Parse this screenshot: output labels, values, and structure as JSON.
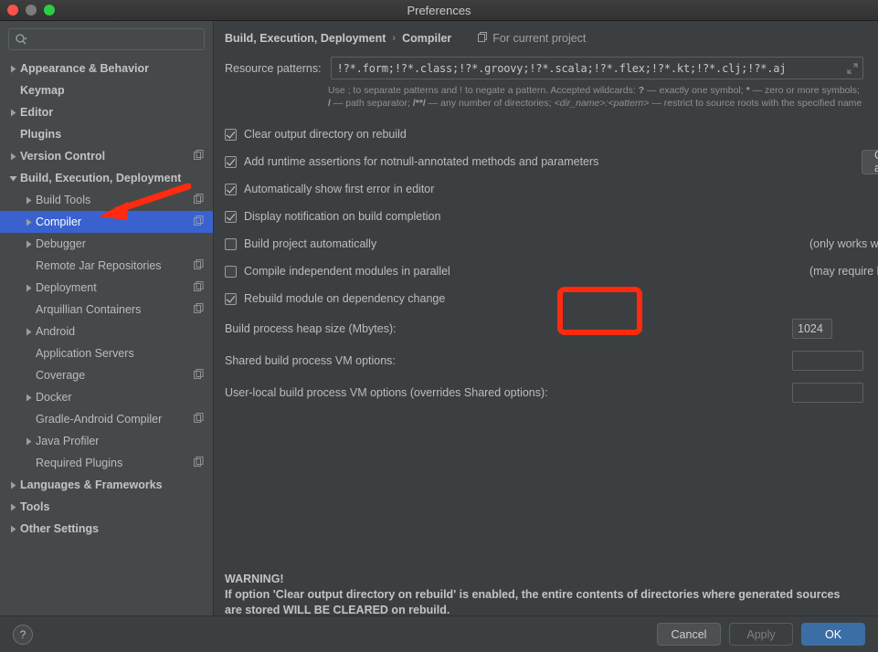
{
  "window": {
    "title": "Preferences",
    "traffic_lights": [
      "close-button",
      "minimize-button",
      "zoom-button"
    ]
  },
  "sidebar": {
    "search": {
      "value": "",
      "placeholder": ""
    },
    "items": [
      {
        "label": "Appearance & Behavior",
        "depth": 0,
        "twisty": "collapsed",
        "bold": true,
        "project_icon": false,
        "selected": false
      },
      {
        "label": "Keymap",
        "depth": 0,
        "twisty": "none",
        "bold": true,
        "project_icon": false,
        "selected": false
      },
      {
        "label": "Editor",
        "depth": 0,
        "twisty": "collapsed",
        "bold": true,
        "project_icon": false,
        "selected": false
      },
      {
        "label": "Plugins",
        "depth": 0,
        "twisty": "none",
        "bold": true,
        "project_icon": false,
        "selected": false
      },
      {
        "label": "Version Control",
        "depth": 0,
        "twisty": "collapsed",
        "bold": true,
        "project_icon": true,
        "selected": false
      },
      {
        "label": "Build, Execution, Deployment",
        "depth": 0,
        "twisty": "expanded",
        "bold": true,
        "project_icon": false,
        "selected": false
      },
      {
        "label": "Build Tools",
        "depth": 1,
        "twisty": "collapsed",
        "bold": false,
        "project_icon": true,
        "selected": false
      },
      {
        "label": "Compiler",
        "depth": 1,
        "twisty": "collapsed",
        "bold": false,
        "project_icon": true,
        "selected": true
      },
      {
        "label": "Debugger",
        "depth": 1,
        "twisty": "collapsed",
        "bold": false,
        "project_icon": false,
        "selected": false
      },
      {
        "label": "Remote Jar Repositories",
        "depth": 1,
        "twisty": "none",
        "bold": false,
        "project_icon": true,
        "selected": false
      },
      {
        "label": "Deployment",
        "depth": 1,
        "twisty": "collapsed",
        "bold": false,
        "project_icon": true,
        "selected": false
      },
      {
        "label": "Arquillian Containers",
        "depth": 1,
        "twisty": "none",
        "bold": false,
        "project_icon": true,
        "selected": false
      },
      {
        "label": "Android",
        "depth": 1,
        "twisty": "collapsed",
        "bold": false,
        "project_icon": false,
        "selected": false
      },
      {
        "label": "Application Servers",
        "depth": 1,
        "twisty": "none",
        "bold": false,
        "project_icon": false,
        "selected": false
      },
      {
        "label": "Coverage",
        "depth": 1,
        "twisty": "none",
        "bold": false,
        "project_icon": true,
        "selected": false
      },
      {
        "label": "Docker",
        "depth": 1,
        "twisty": "collapsed",
        "bold": false,
        "project_icon": false,
        "selected": false
      },
      {
        "label": "Gradle-Android Compiler",
        "depth": 1,
        "twisty": "none",
        "bold": false,
        "project_icon": true,
        "selected": false
      },
      {
        "label": "Java Profiler",
        "depth": 1,
        "twisty": "collapsed",
        "bold": false,
        "project_icon": false,
        "selected": false
      },
      {
        "label": "Required Plugins",
        "depth": 1,
        "twisty": "none",
        "bold": false,
        "project_icon": true,
        "selected": false
      },
      {
        "label": "Languages & Frameworks",
        "depth": 0,
        "twisty": "collapsed",
        "bold": true,
        "project_icon": false,
        "selected": false
      },
      {
        "label": "Tools",
        "depth": 0,
        "twisty": "collapsed",
        "bold": true,
        "project_icon": false,
        "selected": false
      },
      {
        "label": "Other Settings",
        "depth": 0,
        "twisty": "collapsed",
        "bold": true,
        "project_icon": false,
        "selected": false
      }
    ]
  },
  "main": {
    "breadcrumb": {
      "parent": "Build, Execution, Deployment",
      "separator": "›",
      "current": "Compiler",
      "scope_label": "For current project"
    },
    "resource_patterns": {
      "label": "Resource patterns:",
      "value": "!?*.form;!?*.class;!?*.groovy;!?*.scala;!?*.flex;!?*.kt;!?*.clj;!?*.aj",
      "hint_line1_pre": "Use ; to separate patterns and ! to negate a pattern. Accepted wildcards: ",
      "hint_q": "?",
      "hint_q_desc": " — exactly one symbol; ",
      "hint_star": "*",
      "hint_star_desc": " — zero or more symbols; ",
      "hint_slash": "/",
      "hint_slash_desc": " — path separator; ",
      "hint_dblstar": "/**/",
      "hint_dblstar_desc": " — any number of directories; ",
      "hint_dir": "<dir_name>:<pattern>",
      "hint_dir_desc": " — restrict to source roots with the specified name"
    },
    "checkboxes": [
      {
        "label": "Clear output directory on rebuild",
        "checked": true,
        "note": ""
      },
      {
        "label": "Add runtime assertions for notnull-annotated methods and parameters",
        "checked": true,
        "note": ""
      },
      {
        "label": "Automatically show first error in editor",
        "checked": true,
        "note": ""
      },
      {
        "label": "Display notification on build completion",
        "checked": true,
        "note": ""
      },
      {
        "label": "Build project automatically",
        "checked": false,
        "note": "(only works while not running / debugging)"
      },
      {
        "label": "Compile independent modules in parallel",
        "checked": false,
        "note": "(may require larger heap size)"
      },
      {
        "label": "Rebuild module on dependency change",
        "checked": true,
        "note": ""
      }
    ],
    "configure_annotations_button": "Configure annotations...",
    "fields": [
      {
        "label": "Build process heap size (Mbytes):",
        "value": "1024",
        "kind": "small"
      },
      {
        "label": "Shared build process VM options:",
        "value": "",
        "kind": "wide"
      },
      {
        "label": "User-local build process VM options (overrides Shared options):",
        "value": "",
        "kind": "wide"
      }
    ],
    "warning": {
      "title": "WARNING!",
      "line1": "If option 'Clear output directory on rebuild' is enabled, the entire contents of directories where generated sources",
      "line2": "are stored WILL BE CLEARED on rebuild."
    }
  },
  "footer": {
    "help": "?",
    "cancel": "Cancel",
    "apply": "Apply",
    "ok": "OK"
  },
  "annotations": {
    "accent_color": "#ff2a0f",
    "selection_color": "#3a62cf",
    "arrow_target": "Compiler",
    "rect_target": "Build process heap size (Mbytes)"
  }
}
